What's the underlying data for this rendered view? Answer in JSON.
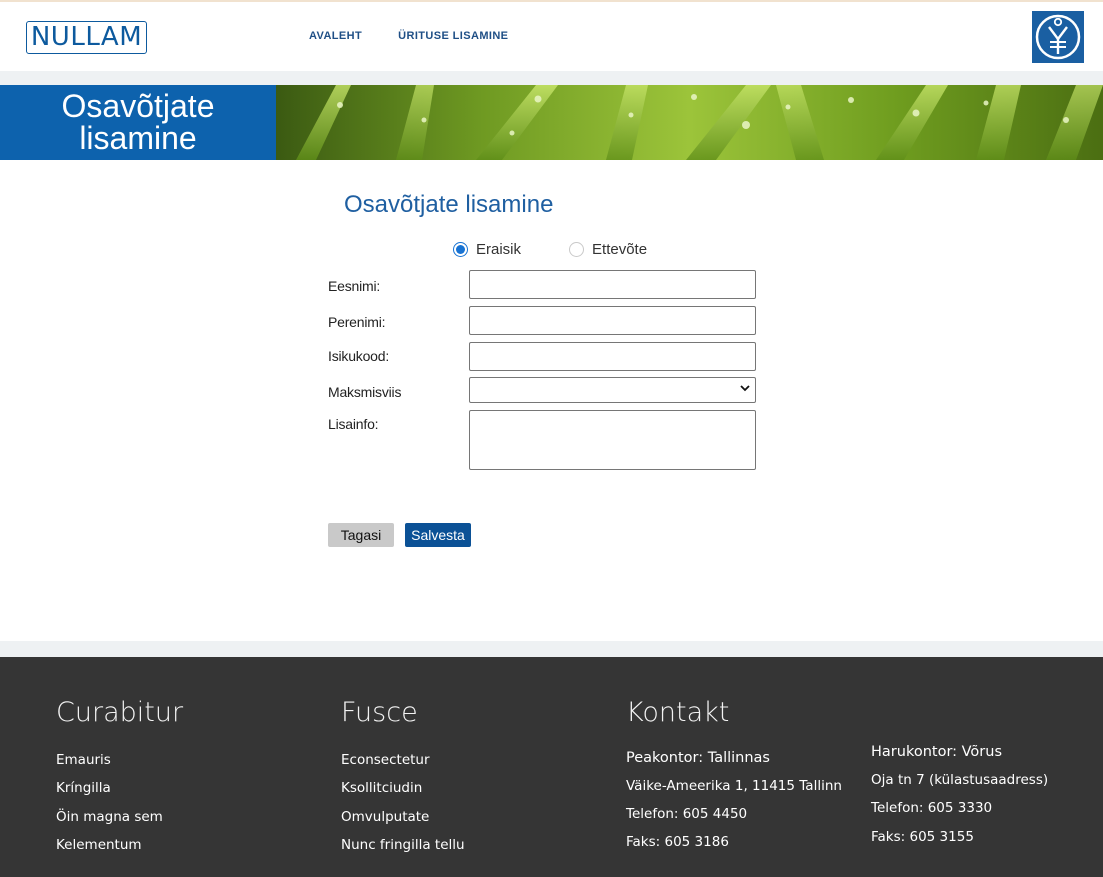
{
  "header": {
    "logo_text": "NULLAM",
    "nav": [
      "AVALEHT",
      "ÜRITUSE LISAMINE"
    ]
  },
  "hero": {
    "title_line1": "Osavõtjate",
    "title_line2": "lisamine"
  },
  "form": {
    "title": "Osavõtjate lisamine",
    "radio_private": "Eraisik",
    "radio_company": "Ettevõte",
    "selected": "Eraisik",
    "labels": {
      "first_name": "Eesnimi:",
      "last_name": "Perenimi:",
      "id_code": "Isikukood:",
      "payment": "Maksmisviis",
      "info": "Lisainfo:"
    },
    "values": {
      "first_name": "",
      "last_name": "",
      "id_code": "",
      "payment": "",
      "info": ""
    },
    "back_label": "Tagasi",
    "save_label": "Salvesta"
  },
  "footer": {
    "col1": {
      "title": "Curabitur",
      "links": [
        "Emauris",
        "Kríngilla",
        "Öin magna sem",
        "Kelementum"
      ]
    },
    "col2": {
      "title": "Fusce",
      "links": [
        "Econsectetur",
        "Ksollitciudin",
        "Omvulputate",
        "Nunc fringilla tellu"
      ]
    },
    "contact": {
      "title": "Kontakt",
      "main": [
        "Peakontor: Tallinnas",
        "Väike-Ameerika 1, 11415 Tallinn",
        "Telefon: 605 4450",
        "Faks: 605 3186"
      ],
      "branch": [
        "Harukontor: Võrus",
        "Oja tn 7 (külastusaadress)",
        "Telefon: 605 3330",
        "Faks: 605 3155"
      ]
    }
  },
  "colors": {
    "brand_blue": "#0d62ad",
    "footer_bg": "#353535",
    "save_button": "#0b5196"
  },
  "icons": [
    "symbol-logo-icon",
    "chevron-down-icon"
  ]
}
